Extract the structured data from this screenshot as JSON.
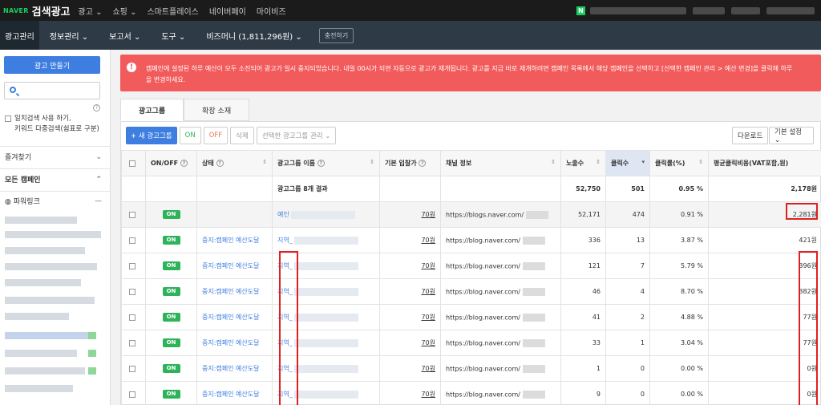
{
  "topbar": {
    "naver": "NAVER",
    "brand": "검색광고",
    "menu": [
      "광고 ⌄",
      "쇼핑 ⌄",
      "스마트플레이스",
      "네이버페이",
      "마이비즈"
    ],
    "badge": "N"
  },
  "navbar": {
    "items": [
      "광고관리",
      "정보관리 ⌄",
      "보고서 ⌄",
      "도구 ⌄",
      "비즈머니 (1,811,296원) ⌄"
    ],
    "charge": "충전하기"
  },
  "sidebar": {
    "create_button": "광고 만들기",
    "search_placeholder": "",
    "exact_match": "일치검색 사용 하기,\n키워드 다중검색(쉼표로 구분)",
    "help": "?",
    "favorites": "즐겨찾기",
    "all_campaigns": "모든 캠페인",
    "powerlink": "파워링크"
  },
  "alert": {
    "icon": "!",
    "text": "캠페인에 설정된 하루 예산이 모두 소진되어 광고가 일시 중지되었습니다. 내일 00시가 되면 자동으로 광고가 재개됩니다. 광고를 지금 바로 재개하려면 캠페인 목록에서 해당 캠페인을 선택하고 [선택한 캠페인 관리 > 예산 변경]을 클릭해 하루\n을 변경하세요."
  },
  "tabs": [
    "광고그룹",
    "확장 소재"
  ],
  "toolbar": {
    "new_group": "+ 새 광고그룹",
    "on": "ON",
    "off": "OFF",
    "delete": "삭제",
    "manage": "선택한 광고그룹 관리 ⌄",
    "download": "다운로드",
    "settings": "기본 설정 ⌄"
  },
  "table": {
    "headers": [
      "ON/OFF",
      "상태",
      "광고그룹 이름",
      "기본 입찰가",
      "채널 정보",
      "노출수",
      "클릭수",
      "클릭률(%)",
      "평균클릭비용(VAT포함,원)"
    ],
    "summary": {
      "label": "광고그룹 8개 결과",
      "impressions": "52,750",
      "clicks": "501",
      "ctr": "0.95 %",
      "cpc": "2,178원"
    },
    "rows": [
      {
        "toggle": "ON",
        "status": "",
        "name": "예인",
        "bid": "70원",
        "channel": "https://blogs.naver.com/",
        "impressions": "52,171",
        "clicks": "474",
        "ctr": "0.91 %",
        "cpc": "2,281원"
      },
      {
        "toggle": "ON",
        "status": "중지:캠페인 예산도달",
        "name": "지역_",
        "bid": "70원",
        "channel": "https://blog.naver.com/",
        "impressions": "336",
        "clicks": "13",
        "ctr": "3.87 %",
        "cpc": "421원"
      },
      {
        "toggle": "ON",
        "status": "중지:캠페인 예산도달",
        "name": "지역_",
        "bid": "70원",
        "channel": "https://blog.naver.com/",
        "impressions": "121",
        "clicks": "7",
        "ctr": "5.79 %",
        "cpc": "396원"
      },
      {
        "toggle": "ON",
        "status": "중지:캠페인 예산도달",
        "name": "지역_",
        "bid": "70원",
        "channel": "https://blog.naver.com/",
        "impressions": "46",
        "clicks": "4",
        "ctr": "8.70 %",
        "cpc": "382원"
      },
      {
        "toggle": "ON",
        "status": "중지:캠페인 예산도달",
        "name": "지역_",
        "bid": "70원",
        "channel": "https://blog.naver.com/",
        "impressions": "41",
        "clicks": "2",
        "ctr": "4.88 %",
        "cpc": "77원"
      },
      {
        "toggle": "ON",
        "status": "중지:캠페인 예산도달",
        "name": "지역_",
        "bid": "70원",
        "channel": "https://blog.naver.com/",
        "impressions": "33",
        "clicks": "1",
        "ctr": "3.04 %",
        "cpc": "77원"
      },
      {
        "toggle": "ON",
        "status": "중지:캠페인 예산도달",
        "name": "지역_",
        "bid": "70원",
        "channel": "https://blog.naver.com/",
        "impressions": "1",
        "clicks": "0",
        "ctr": "0.00 %",
        "cpc": "0원"
      },
      {
        "toggle": "ON",
        "status": "중지:캠페인 예산도달",
        "name": "지역_",
        "bid": "70원",
        "channel": "https://blog.naver.com/",
        "impressions": "9",
        "clicks": "0",
        "ctr": "0.00 %",
        "cpc": "0원"
      }
    ]
  },
  "colors": {
    "accent": "#3d7ee0",
    "alert": "#f25b5b",
    "on": "#2eb35a",
    "highlight": "#e02020",
    "nav": "#2e3a46"
  }
}
